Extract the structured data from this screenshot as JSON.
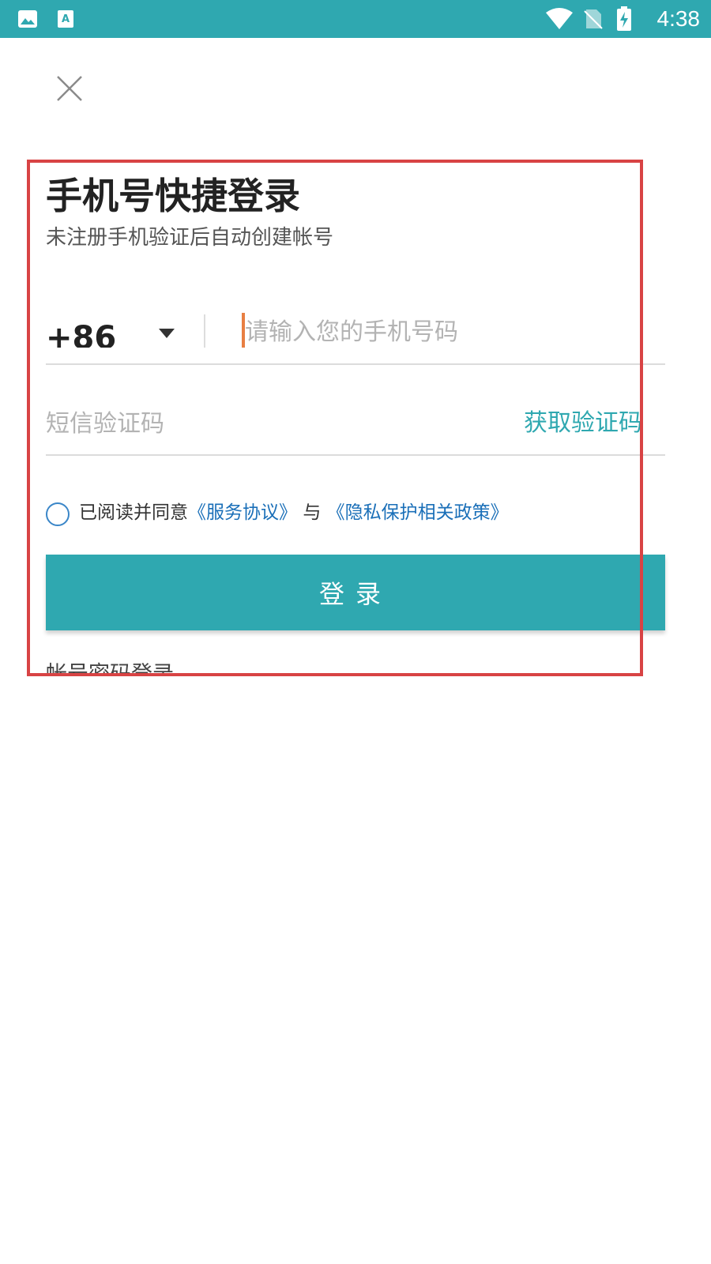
{
  "status_bar": {
    "time": "4:38",
    "left_icons": [
      "image-icon",
      "text-a-icon"
    ],
    "right_icons": [
      "wifi-icon",
      "no-sim-icon",
      "battery-charging-icon"
    ],
    "background": "#2fa8b0"
  },
  "login": {
    "title": "手机号快捷登录",
    "subtitle": "未注册手机验证后自动创建帐号",
    "country_code": "+86",
    "phone_placeholder": "请输入您的手机号码",
    "sms_placeholder": "短信验证码",
    "get_code_label": "获取验证码",
    "agreement": {
      "prefix": "已阅读并同意",
      "service_link": "《服务协议》",
      "connector": "与",
      "privacy_link": "《隐私保护相关政策》",
      "checked": false
    },
    "login_button": "登录",
    "password_login": "帐号密码登录"
  },
  "colors": {
    "accent": "#2fa8b0",
    "link": "#1a6fb8",
    "highlight_border": "#d84344",
    "caret": "#e87f42"
  }
}
